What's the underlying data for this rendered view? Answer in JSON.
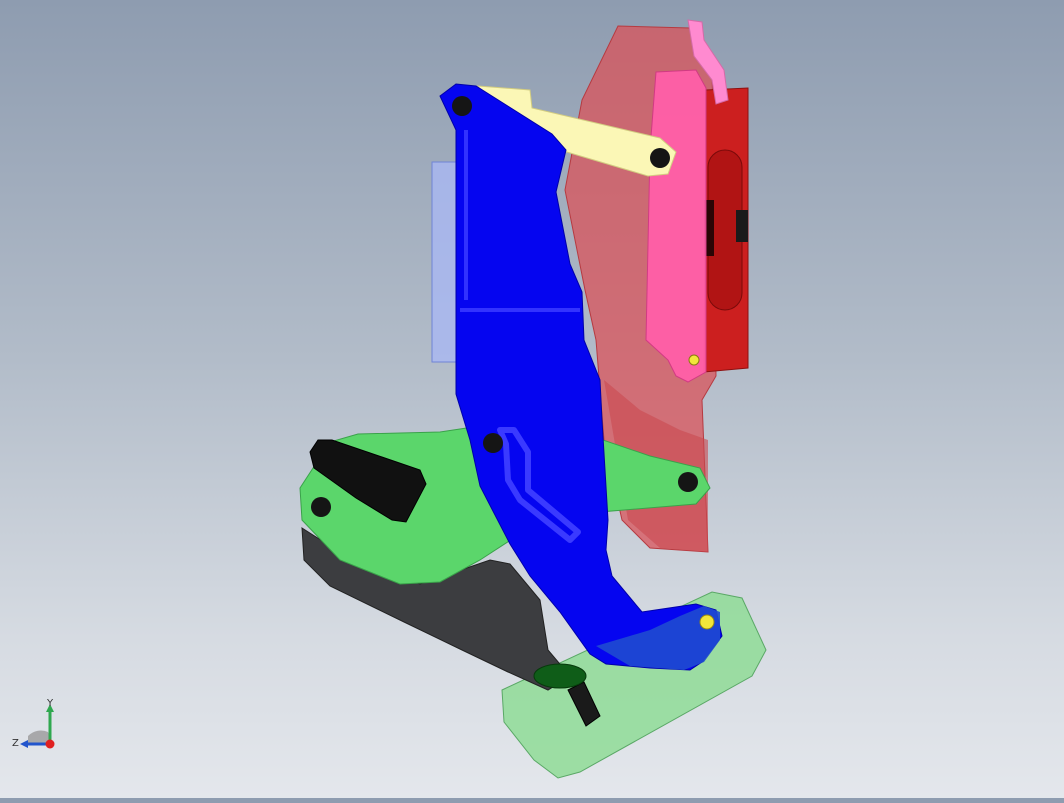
{
  "viewport": {
    "background_top": "#8e9cb0",
    "background_bottom": "#e4e7ec"
  },
  "parts": {
    "red_housing": "#d9535a",
    "pink_slider": "#ff5fa8",
    "dark_red_handle": "#cc1f1f",
    "blue_lever": "#0505f0",
    "yellow_link": "#fbf7b6",
    "green_arm": "#5bd66b",
    "light_green_base": "#8fdc97",
    "dark_grey_pad": "#3c3d40",
    "black_grip": "#111111",
    "pin_color": "#151515",
    "yellow_pin": "#f2e63a"
  },
  "triad": {
    "y_label": "Y",
    "z_label": "Z",
    "y_color": "#2fa84f",
    "z_color": "#2255cc",
    "x_color": "#e02020"
  }
}
